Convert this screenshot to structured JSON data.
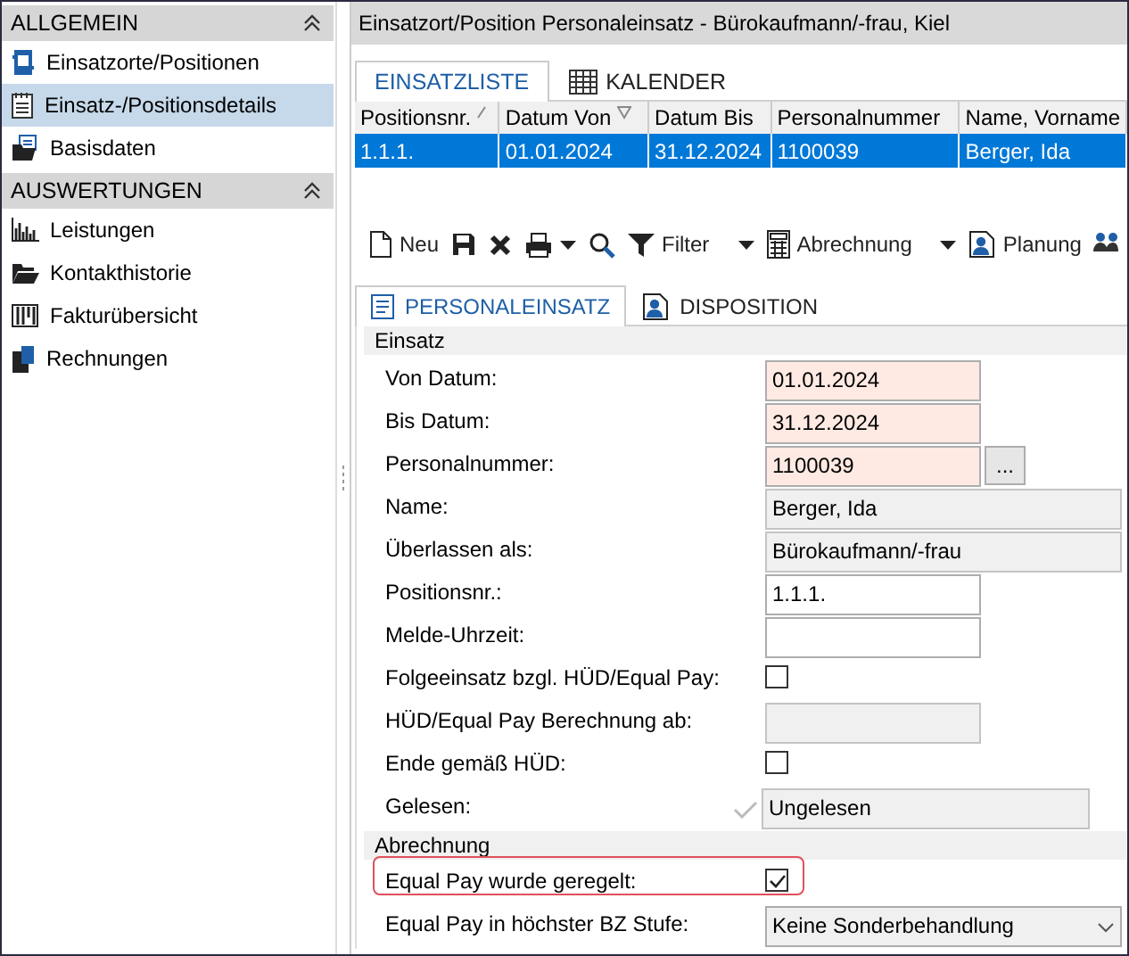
{
  "sidebar": {
    "groups": [
      {
        "title": "ALLGEMEIN",
        "expanded": true,
        "items": [
          {
            "label": "Einsatzorte/Positionen",
            "selected": false
          },
          {
            "label": "Einsatz-/Positionsdetails",
            "selected": true
          },
          {
            "label": "Basisdaten",
            "selected": false
          }
        ]
      },
      {
        "title": "AUSWERTUNGEN",
        "expanded": true,
        "items": [
          {
            "label": "Leistungen",
            "selected": false
          },
          {
            "label": "Kontakthistorie",
            "selected": false
          },
          {
            "label": "Fakturübersicht",
            "selected": false
          },
          {
            "label": "Rechnungen",
            "selected": false
          }
        ]
      }
    ]
  },
  "main": {
    "title": "Einsatzort/Position Personaleinsatz - Bürokaufmann/-frau, Kiel",
    "tabs": [
      {
        "label": "EINSATZLISTE",
        "selected": true
      },
      {
        "label": "KALENDER",
        "selected": false
      }
    ],
    "table": {
      "columns": [
        {
          "label": "Positionsnr.",
          "sorted": true,
          "filtered": false
        },
        {
          "label": "Datum Von",
          "sorted": false,
          "filtered": true
        },
        {
          "label": "Datum Bis",
          "sorted": false,
          "filtered": false
        },
        {
          "label": "Personalnummer",
          "sorted": false,
          "filtered": false
        },
        {
          "label": "Name, Vorname",
          "sorted": false,
          "filtered": false
        }
      ],
      "rows": [
        {
          "cells": [
            "1.1.1.",
            "01.01.2024",
            "31.12.2024",
            "1100039",
            "Berger, Ida"
          ],
          "selected": true
        }
      ]
    },
    "toolbar": [
      {
        "label": "Neu",
        "dropdown": false
      },
      {
        "dropdown": false
      },
      {
        "dropdown": false
      },
      {
        "dropdown": true
      },
      {
        "dropdown": false
      },
      {
        "label": "Filter",
        "dropdown": true
      },
      {
        "label": "Abrechnung",
        "dropdown": true
      },
      {
        "label": "Planung",
        "dropdown": false
      },
      {
        "dropdown": false
      }
    ],
    "detail_tabs": [
      {
        "label": "PERSONALEINSATZ",
        "selected": true
      },
      {
        "label": "DISPOSITION",
        "selected": false
      }
    ],
    "sections": [
      {
        "title": "Einsatz",
        "fields": [
          {
            "kind": "text",
            "label": "Von Datum:",
            "value": "01.01.2024",
            "required": true
          },
          {
            "kind": "text",
            "label": "Bis Datum:",
            "value": "31.12.2024",
            "required": true
          },
          {
            "kind": "lookup",
            "label": "Personalnummer:",
            "value": "1100039",
            "button_label": "...",
            "required": true
          },
          {
            "kind": "display",
            "label": "Name:",
            "value": "Berger, Ida"
          },
          {
            "kind": "display",
            "label": "Überlassen als:",
            "value": "Bürokaufmann/-frau"
          },
          {
            "kind": "text",
            "label": "Positionsnr.:",
            "value": "1.1.1.",
            "required": false
          },
          {
            "kind": "text",
            "label": "Melde-Uhrzeit:",
            "required": false
          },
          {
            "kind": "checkbox",
            "label": "Folgeeinsatz bzgl. HÜD/Equal Pay:",
            "checked": false
          },
          {
            "kind": "locked",
            "label": "HÜD/Equal Pay Berechnung ab:"
          },
          {
            "kind": "checkbox",
            "label": "Ende gemäß HÜD:",
            "checked": false
          },
          {
            "kind": "status",
            "label": "Gelesen:",
            "value": "Ungelesen"
          }
        ]
      },
      {
        "title": "Abrechnung",
        "fields": [
          {
            "kind": "checkbox",
            "label": "Equal Pay wurde geregelt:",
            "checked": true,
            "highlighted": true
          },
          {
            "kind": "select",
            "label": "Equal Pay in höchster BZ Stufe:",
            "value": "Keine Sonderbehandlung"
          }
        ]
      }
    ]
  }
}
